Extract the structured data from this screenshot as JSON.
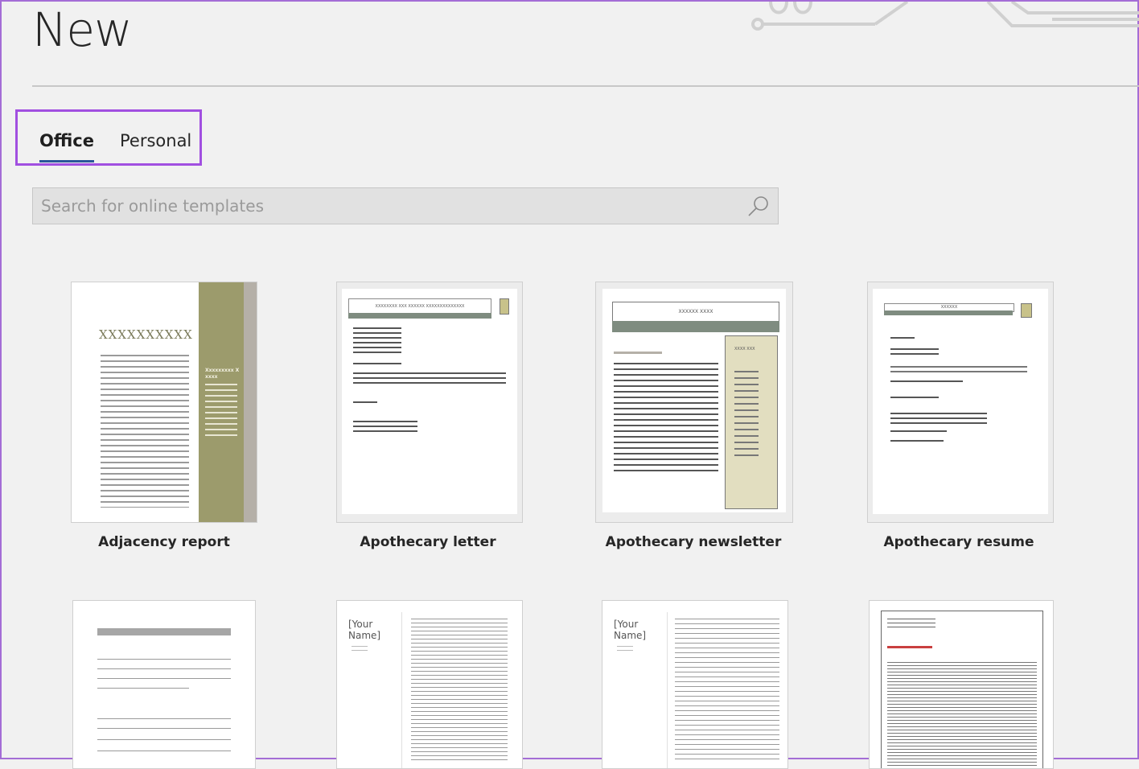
{
  "page": {
    "title": "New"
  },
  "tabs": [
    {
      "label": "Office",
      "selected": true
    },
    {
      "label": "Personal",
      "selected": false
    }
  ],
  "search": {
    "placeholder": "Search for online templates",
    "icon": "search-icon"
  },
  "templates": [
    {
      "label": "Adjacency report",
      "thumb_title": "XXXXXXXXXX",
      "thumb_side_text": "Xxxxxxxxx X xxxx"
    },
    {
      "label": "Apothecary letter",
      "thumb_title": "XXXXXXXX XXX XXXXXX XXXXXXXXXXXXXX"
    },
    {
      "label": "Apothecary newsletter",
      "thumb_title": "XXXXXX XXXX",
      "thumb_side_text": "XXXX XXX"
    },
    {
      "label": "Apothecary resume",
      "thumb_title": "XXXXXX"
    },
    {
      "label": "",
      "thumb_title": ""
    },
    {
      "label": "",
      "thumb_title": "[Your Name]"
    },
    {
      "label": "",
      "thumb_title": "[Your Name]"
    },
    {
      "label": "",
      "thumb_title": ""
    }
  ],
  "colors": {
    "accent": "#2b579a",
    "highlight": "#a14fe0",
    "olive": "#9c9b6c",
    "sage": "#7f8c80",
    "beige": "#e2dec0"
  }
}
